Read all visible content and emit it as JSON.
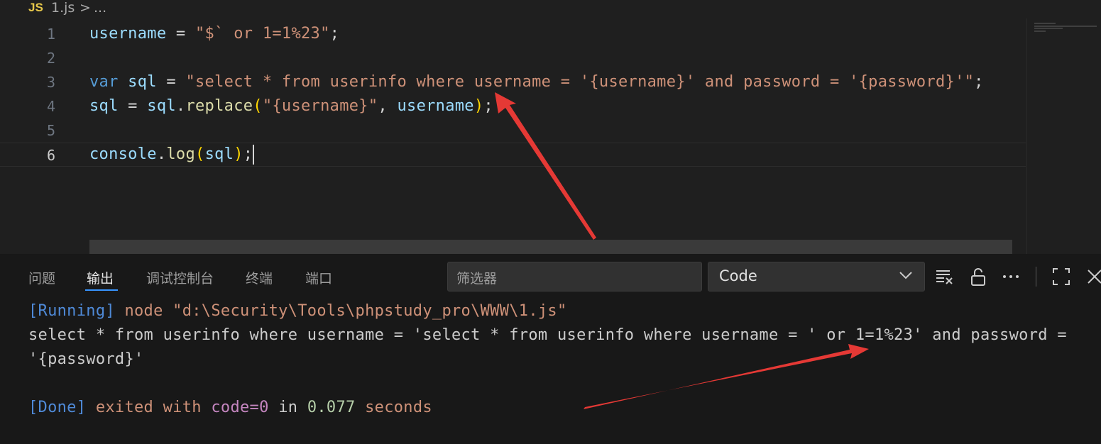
{
  "breadcrumb": {
    "lang_badge": "JS",
    "file": "1.js",
    "separator": ">",
    "more": "..."
  },
  "editor": {
    "line_numbers": [
      "1",
      "2",
      "3",
      "4",
      "5",
      "6"
    ],
    "active_line": 6,
    "lines": {
      "l1": {
        "var": "username",
        "op": " = ",
        "str": "\"$` or 1=1%23\"",
        "end": ";"
      },
      "l3": {
        "kw": "var",
        "var": " sql",
        "op": " = ",
        "str": "\"select * from userinfo where username = '{username}' and password = '{password}'\"",
        "end": ";"
      },
      "l4": {
        "var1": "sql",
        "op": " = ",
        "var2": "sql",
        "dot": ".",
        "fn": "replace",
        "open": "(",
        "str": "\"{username}\"",
        "comma": ", ",
        "var3": "username",
        "close": ")",
        "end": ";"
      },
      "l6": {
        "var": "console",
        "dot": ".",
        "fn": "log",
        "open": "(",
        "arg": "sql",
        "close": ")",
        "end": ";"
      }
    }
  },
  "panel": {
    "tabs": [
      "问题",
      "输出",
      "调试控制台",
      "终端",
      "端口"
    ],
    "active_tab": "输出",
    "filter_placeholder": "筛选器",
    "channel": "Code",
    "icons": [
      "clear-output-icon",
      "lock-icon",
      "more-icon",
      "maximize-icon",
      "close-icon"
    ],
    "output": {
      "running_tag": "[Running]",
      "running_cmd": " node \"d:\\Security\\Tools\\phpstudy_pro\\WWW\\1.js\"",
      "result_line1": "select * from userinfo where username = 'select * from userinfo where username = ' or 1=1%23' and password =",
      "result_line2": "'{password}'",
      "done_tag": "[Done]",
      "done_exited": " exited with ",
      "done_code": "code=0",
      "done_in": " in ",
      "done_time": "0.077",
      "done_seconds": " seconds"
    }
  },
  "colors": {
    "annotation_arrow": "#e53935",
    "accent": "#3794ff"
  }
}
